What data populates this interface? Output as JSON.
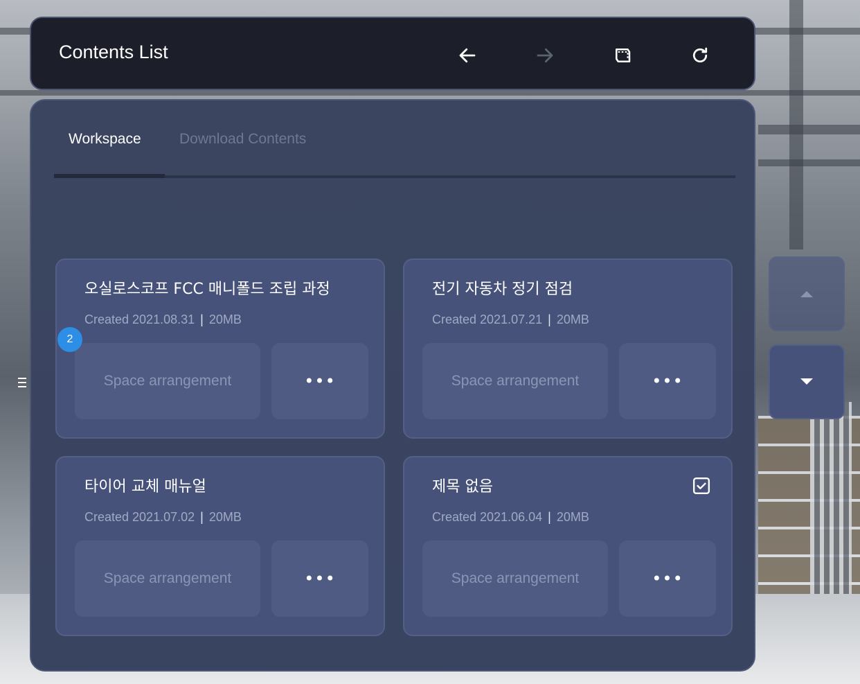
{
  "header": {
    "title": "Contents List",
    "buttons": [
      {
        "name": "back-button",
        "icon": "arrow-left-icon",
        "enabled": true
      },
      {
        "name": "forward-button",
        "icon": "arrow-right-icon",
        "enabled": false
      },
      {
        "name": "window-button",
        "icon": "window-frame-icon",
        "enabled": true
      },
      {
        "name": "refresh-button",
        "icon": "refresh-icon",
        "enabled": true
      }
    ]
  },
  "tabs": [
    {
      "label": "Workspace",
      "active": true
    },
    {
      "label": "Download Contents",
      "active": false
    }
  ],
  "badge": "2",
  "cards": [
    {
      "title": "오실로스코프 FCC 매니폴드 조립 과정",
      "created": "Created 2021.08.31",
      "size": "20MB",
      "space_label": "Space arrangement",
      "more_label": "•••",
      "checked": false
    },
    {
      "title": "전기 자동차 정기 점검",
      "created": "Created 2021.07.21",
      "size": "20MB",
      "space_label": "Space arrangement",
      "more_label": "•••",
      "checked": false
    },
    {
      "title": "타이어 교체 매뉴얼",
      "created": "Created 2021.07.02",
      "size": "20MB",
      "space_label": "Space arrangement",
      "more_label": "•••",
      "checked": false
    },
    {
      "title": "제목 없음",
      "created": "Created 2021.06.04",
      "size": "20MB",
      "space_label": "Space arrangement",
      "more_label": "•••",
      "checked": true
    }
  ],
  "separator": "|",
  "scroll": {
    "up_icon": "caret-up-icon",
    "down_icon": "caret-down-icon"
  },
  "colors": {
    "accent": "#2d8ee6",
    "card": "#46527a",
    "panel": "#3b4560",
    "header": "#1c1f29"
  }
}
